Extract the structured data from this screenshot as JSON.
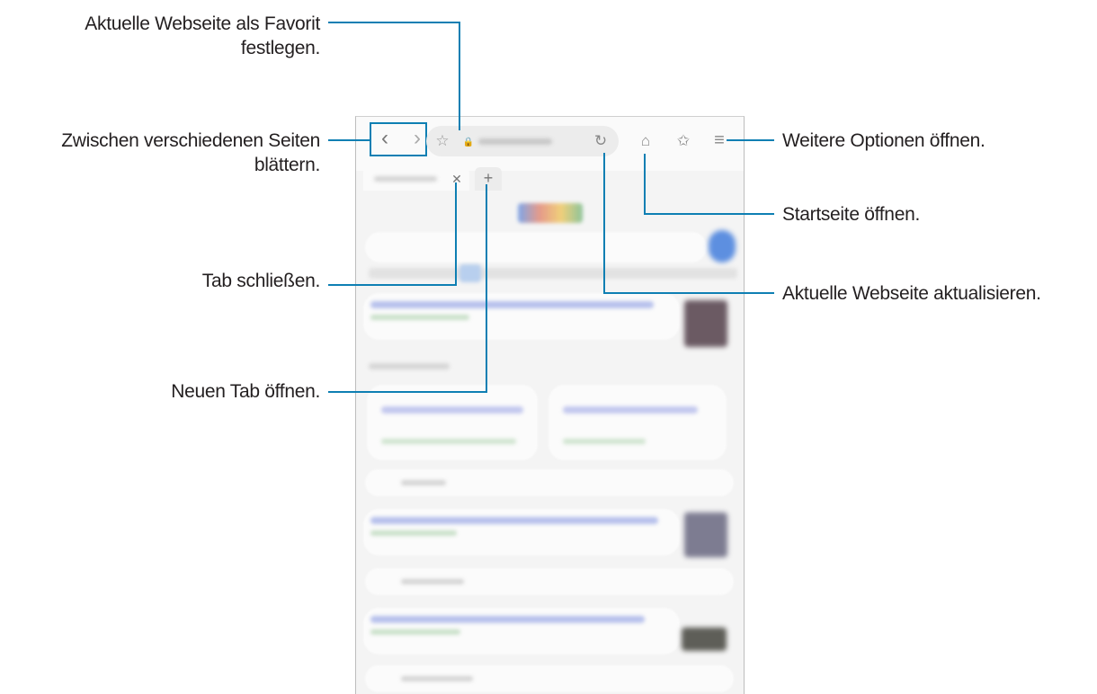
{
  "annotations": {
    "favorite": [
      "Aktuelle Webseite als Favorit",
      "festlegen."
    ],
    "navigate": [
      "Zwischen verschiedenen Seiten",
      "blättern."
    ],
    "close_tab": "Tab schließen.",
    "new_tab": "Neuen Tab öffnen.",
    "more_options": "Weitere Optionen öffnen.",
    "home": "Startseite öffnen.",
    "refresh": "Aktuelle Webseite aktualisieren."
  },
  "browser": {
    "icons": {
      "back": "‹",
      "forward": "›",
      "favorite_star": "☆",
      "lock": "🔒",
      "refresh": "↻",
      "home": "⌂",
      "bookmarks": "✩",
      "menu": "≡",
      "close_tab": "✕",
      "new_tab": "+"
    }
  },
  "colors": {
    "callout_line": "#0e7fb3",
    "highlight_box": "#0e7fb3"
  }
}
